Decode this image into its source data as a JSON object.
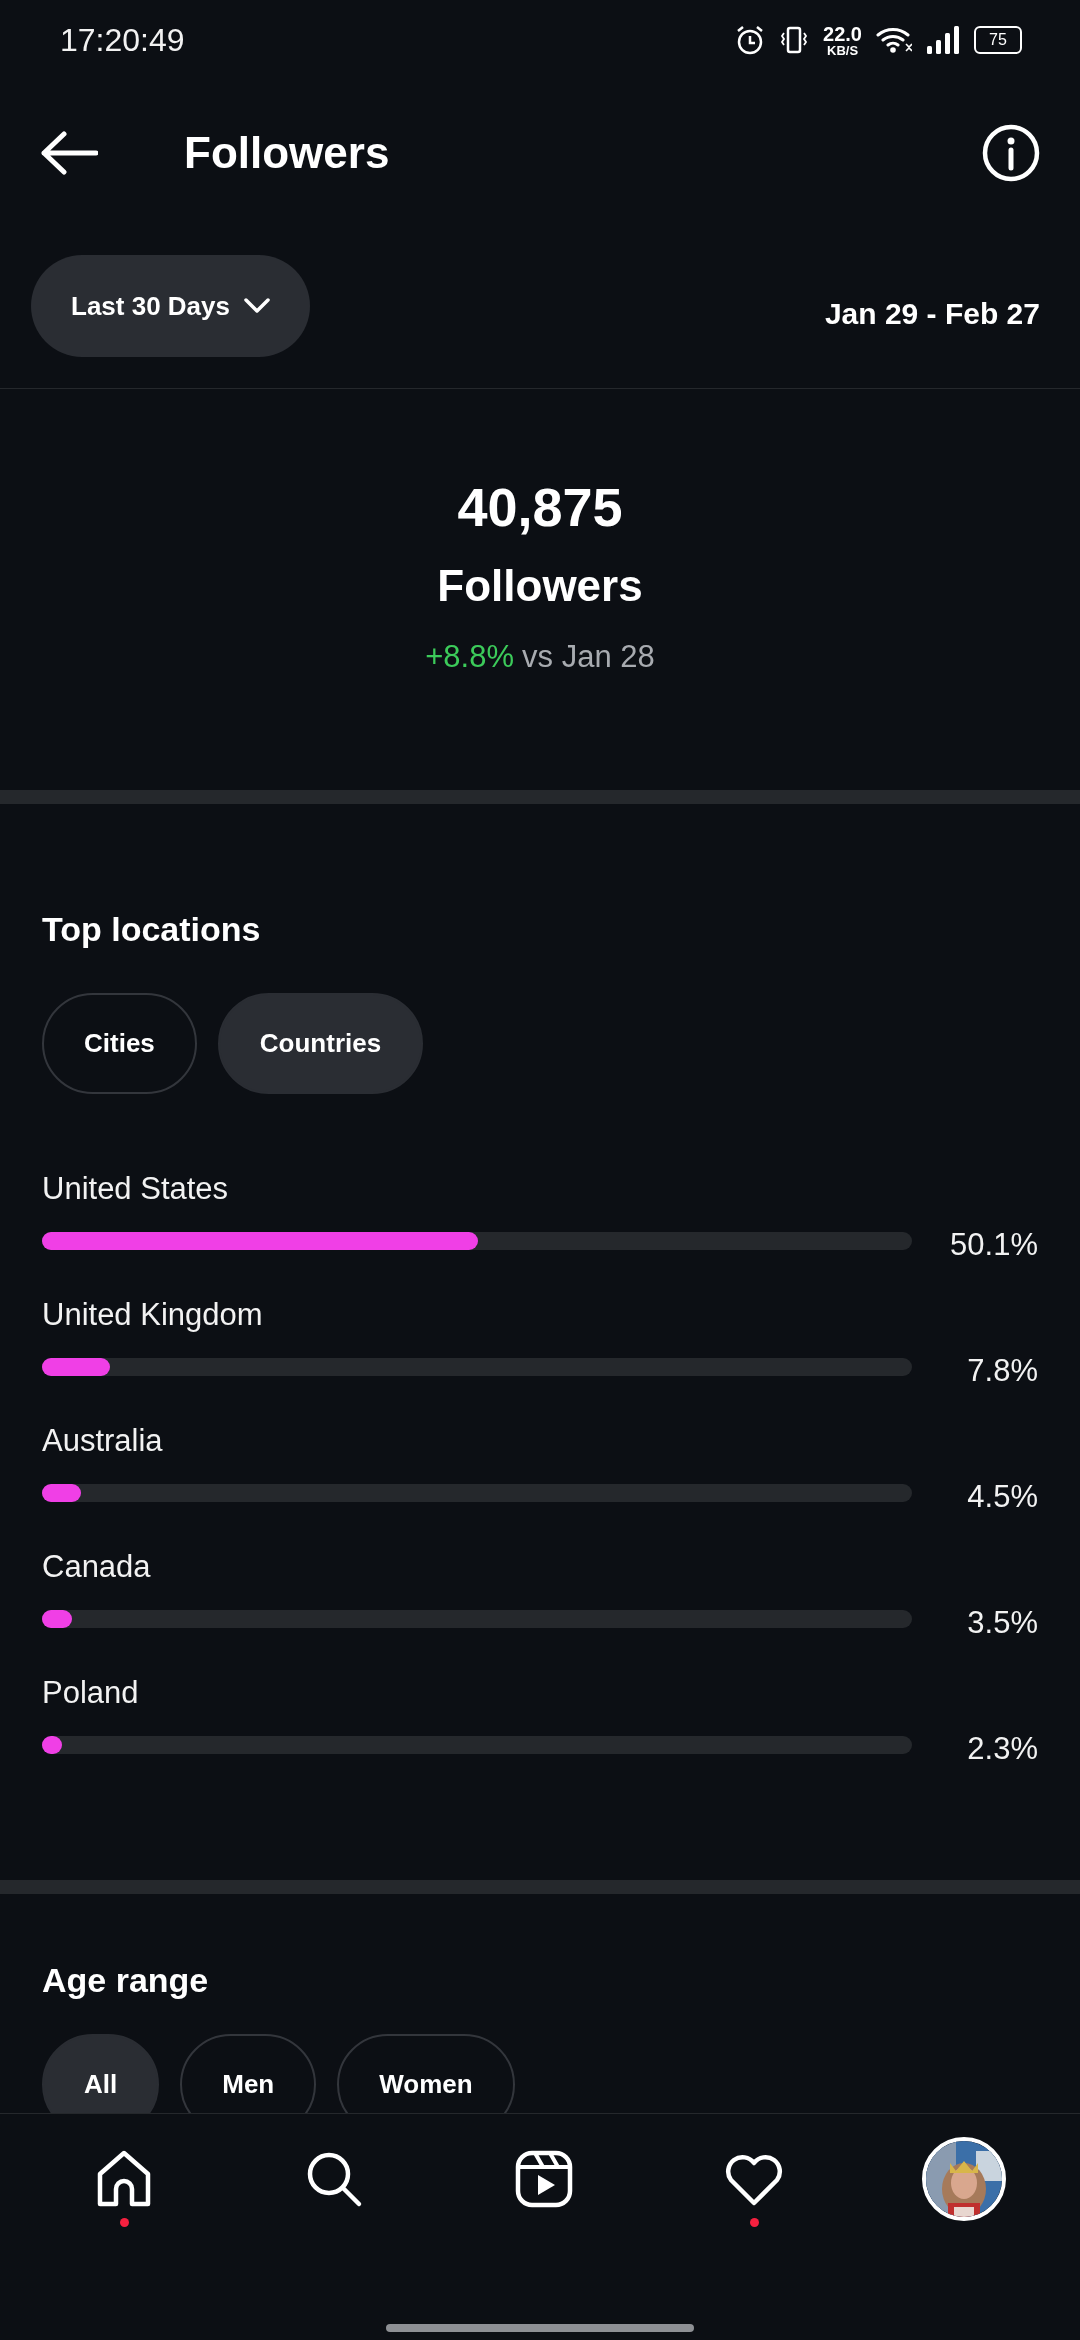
{
  "status_bar": {
    "time": "17:20:49",
    "speed_value": "22.0",
    "speed_unit": "KB/S",
    "battery": "75"
  },
  "header": {
    "title": "Followers"
  },
  "filter": {
    "label": "Last 30 Days",
    "date_range": "Jan 29 - Feb 27"
  },
  "summary": {
    "count": "40,875",
    "label": "Followers",
    "change": "+8.8%",
    "comparison": "vs Jan 28"
  },
  "top_locations": {
    "title": "Top locations",
    "tabs": [
      {
        "label": "Cities",
        "selected": false
      },
      {
        "label": "Countries",
        "selected": true
      }
    ],
    "rows": [
      {
        "name": "United States",
        "level": 0.501,
        "reading": "50.1%"
      },
      {
        "name": "United Kingdom",
        "level": 0.078,
        "reading": "7.8%"
      },
      {
        "name": "Australia",
        "level": 0.045,
        "reading": "4.5%"
      },
      {
        "name": "Canada",
        "level": 0.035,
        "reading": "3.5%"
      },
      {
        "name": "Poland",
        "level": 0.023,
        "reading": "2.3%"
      }
    ]
  },
  "age_range": {
    "title": "Age range",
    "tabs": [
      {
        "label": "All",
        "selected": true
      },
      {
        "label": "Men",
        "selected": false
      },
      {
        "label": "Women",
        "selected": false
      }
    ]
  },
  "nav": [
    {
      "kind": "home",
      "notification": true
    },
    {
      "kind": "search",
      "notification": false
    },
    {
      "kind": "reels",
      "notification": false
    },
    {
      "kind": "activity",
      "notification": true
    },
    {
      "kind": "profile",
      "notification": false
    }
  ]
}
